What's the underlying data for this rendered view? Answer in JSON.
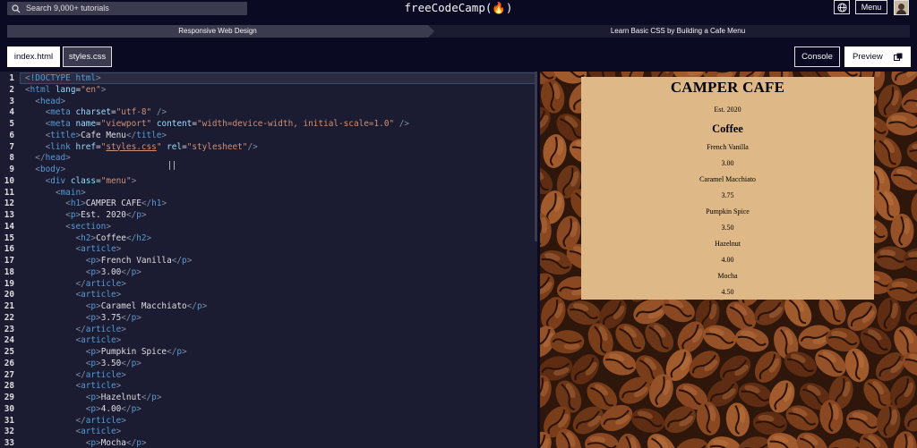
{
  "nav": {
    "search_placeholder": "Search 9,000+ tutorials",
    "logo": "freeCodeCamp(🔥)",
    "menu_label": "Menu"
  },
  "breadcrumb": {
    "course": "Responsive Web Design",
    "lesson": "Learn Basic CSS by Building a Cafe Menu"
  },
  "tabs": {
    "index": "index.html",
    "styles": "styles.css",
    "console": "Console",
    "preview": "Preview"
  },
  "editor": {
    "lines": [
      {
        "n": "1",
        "html": "<span class='g'>&lt;</span><span class='dt'>!DOCTYPE</span> <span class='tg'>html</span><span class='g'>&gt;</span>"
      },
      {
        "n": "2",
        "html": "<span class='g'>&lt;</span><span class='tg'>html</span> <span class='at'>lang</span>=<span class='st'>\"en\"</span><span class='g'>&gt;</span>"
      },
      {
        "n": "3",
        "html": "  <span class='g'>&lt;</span><span class='tg'>head</span><span class='g'>&gt;</span>"
      },
      {
        "n": "4",
        "html": "    <span class='g'>&lt;</span><span class='tg'>meta</span> <span class='at'>charset</span>=<span class='st'>\"utf-8\"</span> <span class='g'>/&gt;</span>"
      },
      {
        "n": "5",
        "html": "    <span class='g'>&lt;</span><span class='tg'>meta</span> <span class='at'>name</span>=<span class='st'>\"viewport\"</span> <span class='at'>content</span>=<span class='st'>\"width=device-width, initial-scale=1.0\"</span> <span class='g'>/&gt;</span>"
      },
      {
        "n": "6",
        "html": "    <span class='g'>&lt;</span><span class='tg'>title</span><span class='g'>&gt;</span><span class='tx'>Cafe Menu</span><span class='g'>&lt;/</span><span class='tg'>title</span><span class='g'>&gt;</span>"
      },
      {
        "n": "7",
        "html": "    <span class='g'>&lt;</span><span class='tg'>link</span> <span class='at'>href</span>=<span class='st'>\"<span class='ul'>styles.css</span>\"</span> <span class='at'>rel</span>=<span class='st'>\"stylesheet\"</span><span class='g'>/&gt;</span>"
      },
      {
        "n": "8",
        "html": "  <span class='g'>&lt;/</span><span class='tg'>head</span><span class='g'>&gt;</span>"
      },
      {
        "n": "9",
        "html": "  <span class='g'>&lt;</span><span class='tg'>body</span><span class='g'>&gt;</span>"
      },
      {
        "n": "10",
        "html": "    <span class='g'>&lt;</span><span class='tg'>div</span> <span class='at'>class</span>=<span class='st'>\"menu\"</span><span class='g'>&gt;</span>"
      },
      {
        "n": "11",
        "html": "      <span class='g'>&lt;</span><span class='tg'>main</span><span class='g'>&gt;</span>"
      },
      {
        "n": "12",
        "html": "        <span class='g'>&lt;</span><span class='tg'>h1</span><span class='g'>&gt;</span><span class='tx'>CAMPER CAFE</span><span class='g'>&lt;/</span><span class='tg'>h1</span><span class='g'>&gt;</span>"
      },
      {
        "n": "13",
        "html": "        <span class='g'>&lt;</span><span class='tg'>p</span><span class='g'>&gt;</span><span class='tx'>Est. 2020</span><span class='g'>&lt;/</span><span class='tg'>p</span><span class='g'>&gt;</span>"
      },
      {
        "n": "14",
        "html": "        <span class='g'>&lt;</span><span class='tg'>section</span><span class='g'>&gt;</span>"
      },
      {
        "n": "15",
        "html": "          <span class='g'>&lt;</span><span class='tg'>h2</span><span class='g'>&gt;</span><span class='tx'>Coffee</span><span class='g'>&lt;/</span><span class='tg'>h2</span><span class='g'>&gt;</span>"
      },
      {
        "n": "16",
        "html": "          <span class='g'>&lt;</span><span class='tg'>article</span><span class='g'>&gt;</span>"
      },
      {
        "n": "17",
        "html": "            <span class='g'>&lt;</span><span class='tg'>p</span><span class='g'>&gt;</span><span class='tx'>French Vanilla</span><span class='g'>&lt;/</span><span class='tg'>p</span><span class='g'>&gt;</span>"
      },
      {
        "n": "18",
        "html": "            <span class='g'>&lt;</span><span class='tg'>p</span><span class='g'>&gt;</span><span class='tx'>3.00</span><span class='g'>&lt;/</span><span class='tg'>p</span><span class='g'>&gt;</span>"
      },
      {
        "n": "19",
        "html": "          <span class='g'>&lt;/</span><span class='tg'>article</span><span class='g'>&gt;</span>"
      },
      {
        "n": "20",
        "html": "          <span class='g'>&lt;</span><span class='tg'>article</span><span class='g'>&gt;</span>"
      },
      {
        "n": "21",
        "html": "            <span class='g'>&lt;</span><span class='tg'>p</span><span class='g'>&gt;</span><span class='tx'>Caramel Macchiato</span><span class='g'>&lt;/</span><span class='tg'>p</span><span class='g'>&gt;</span>"
      },
      {
        "n": "22",
        "html": "            <span class='g'>&lt;</span><span class='tg'>p</span><span class='g'>&gt;</span><span class='tx'>3.75</span><span class='g'>&lt;/</span><span class='tg'>p</span><span class='g'>&gt;</span>"
      },
      {
        "n": "23",
        "html": "          <span class='g'>&lt;/</span><span class='tg'>article</span><span class='g'>&gt;</span>"
      },
      {
        "n": "24",
        "html": "          <span class='g'>&lt;</span><span class='tg'>article</span><span class='g'>&gt;</span>"
      },
      {
        "n": "25",
        "html": "            <span class='g'>&lt;</span><span class='tg'>p</span><span class='g'>&gt;</span><span class='tx'>Pumpkin Spice</span><span class='g'>&lt;/</span><span class='tg'>p</span><span class='g'>&gt;</span>"
      },
      {
        "n": "26",
        "html": "            <span class='g'>&lt;</span><span class='tg'>p</span><span class='g'>&gt;</span><span class='tx'>3.50</span><span class='g'>&lt;/</span><span class='tg'>p</span><span class='g'>&gt;</span>"
      },
      {
        "n": "27",
        "html": "          <span class='g'>&lt;/</span><span class='tg'>article</span><span class='g'>&gt;</span>"
      },
      {
        "n": "28",
        "html": "          <span class='g'>&lt;</span><span class='tg'>article</span><span class='g'>&gt;</span>"
      },
      {
        "n": "29",
        "html": "            <span class='g'>&lt;</span><span class='tg'>p</span><span class='g'>&gt;</span><span class='tx'>Hazelnut</span><span class='g'>&lt;/</span><span class='tg'>p</span><span class='g'>&gt;</span>"
      },
      {
        "n": "30",
        "html": "            <span class='g'>&lt;</span><span class='tg'>p</span><span class='g'>&gt;</span><span class='tx'>4.00</span><span class='g'>&lt;/</span><span class='tg'>p</span><span class='g'>&gt;</span>"
      },
      {
        "n": "31",
        "html": "          <span class='g'>&lt;/</span><span class='tg'>article</span><span class='g'>&gt;</span>"
      },
      {
        "n": "32",
        "html": "          <span class='g'>&lt;</span><span class='tg'>article</span><span class='g'>&gt;</span>"
      },
      {
        "n": "33",
        "html": "            <span class='g'>&lt;</span><span class='tg'>p</span><span class='g'>&gt;</span><span class='tx'>Mocha</span><span class='g'>&lt;/</span><span class='tg'>p</span><span class='g'>&gt;</span>"
      }
    ]
  },
  "preview_menu": {
    "title": "CAMPER CAFE",
    "est": "Est. 2020",
    "section": "Coffee",
    "items": [
      {
        "name": "French Vanilla",
        "price": "3.00"
      },
      {
        "name": "Caramel Macchiato",
        "price": "3.75"
      },
      {
        "name": "Pumpkin Spice",
        "price": "3.50"
      },
      {
        "name": "Hazelnut",
        "price": "4.00"
      },
      {
        "name": "Mocha",
        "price": "4.50"
      }
    ]
  },
  "colors": {
    "bg": "#0a0a23",
    "editor_bg": "#1b1b32",
    "menu_bg": "#deb887",
    "coffee": "#6b3517"
  }
}
